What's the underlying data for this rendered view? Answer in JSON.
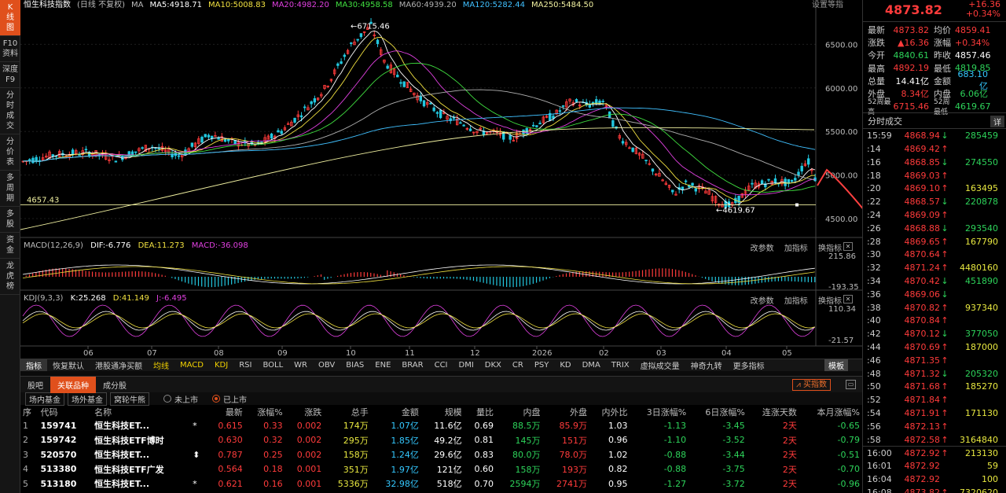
{
  "sidebar": [
    {
      "label": "K 线 图",
      "active": true
    },
    {
      "label": "F10 资料",
      "active": false
    },
    {
      "label": "深度 F9",
      "active": false
    },
    {
      "label": "分 时 成 交",
      "active": false
    },
    {
      "label": "分 价 表",
      "active": false
    },
    {
      "label": "多 周 期",
      "active": false
    },
    {
      "label": "多 股",
      "active": false
    },
    {
      "label": "资 金",
      "active": false
    },
    {
      "label": "龙 虎 榜",
      "active": false
    }
  ],
  "main_chart": {
    "header": [
      {
        "text": "恒生科技指数",
        "color": "#ffffff"
      },
      {
        "text": "(日线 不复权)",
        "color": "#bbbbbb"
      },
      {
        "text": "MA",
        "color": "#bbbbbb"
      },
      {
        "text": "MA5:4918.71",
        "color": "#ffffff"
      },
      {
        "text": "MA10:5008.83",
        "color": "#f0e040"
      },
      {
        "text": "MA20:4982.20",
        "color": "#e040e0"
      },
      {
        "text": "MA30:4958.58",
        "color": "#40e040"
      },
      {
        "text": "MA60:4939.20",
        "color": "#b0b0b0"
      },
      {
        "text": "MA120:5282.44",
        "color": "#40c0ff"
      },
      {
        "text": "MA250:5484.50",
        "color": "#f0f0a0"
      }
    ],
    "header_right": "设置等指",
    "high_label": "6715.46",
    "low_label": "4619.67",
    "ref_line_label": "4657.43",
    "y_ticks": [
      "6500.00",
      "6000.00",
      "5500.00",
      "5000.00",
      "4500.00"
    ],
    "x_ticks": [
      "06",
      "07",
      "08",
      "09",
      "10",
      "11",
      "12",
      "2026",
      "02",
      "03",
      "04",
      "05"
    ]
  },
  "macd": {
    "title": "MACD(12,26,9)",
    "dif": "DIF:-6.776",
    "dea": "DEA:11.273",
    "macd": "MACD:-36.098",
    "y_ticks": [
      "215.86",
      "-193.35"
    ]
  },
  "kdj": {
    "title": "KDJ(9,3,3)",
    "k": "K:25.268",
    "d": "D:41.149",
    "j": "J:-6.495",
    "y_ticks": [
      "110.34",
      "-21.57"
    ]
  },
  "pane_controls": [
    "改参数",
    "加指标",
    "换指标"
  ],
  "indicator_tabs": [
    "指标",
    "恢复默认",
    "港股通净买额",
    "均线",
    "MACD",
    "KDJ",
    "RSI",
    "BOLL",
    "WR",
    "OBV",
    "BIAS",
    "ENE",
    "BRAR",
    "CCI",
    "DMI",
    "DKX",
    "CR",
    "PSY",
    "KD",
    "DMA",
    "TRIX",
    "虚拟成交量",
    "神奇九转",
    "更多指标"
  ],
  "template_label": "模板",
  "bottom_tabs": [
    "股吧",
    "关联品种",
    "成分股"
  ],
  "buy_index_label": "买指数",
  "sub_tabs": [
    "场内基金",
    "场外基金",
    "窝轮牛熊"
  ],
  "radio": {
    "unlisted": "未上市",
    "listed": "已上市"
  },
  "table": {
    "headers": [
      "序",
      "代码",
      "名称",
      "",
      "最新",
      "涨幅%",
      "涨跌",
      "总手",
      "金额",
      "规模",
      "量比",
      "内盘",
      "外盘",
      "内外比",
      "3日涨幅%",
      "6日涨幅%",
      "连涨天数",
      "本月涨幅%"
    ],
    "rows": [
      {
        "idx": "1",
        "code": "159741",
        "name": "恒生科技ET...",
        "mark": "*",
        "last": "0.615",
        "pct": "0.33",
        "chg": "0.002",
        "vol": "174万",
        "amt": "1.07亿",
        "scale": "11.6亿",
        "vr": "0.69",
        "inner": "88.5万",
        "outer": "85.9万",
        "ratio": "1.03",
        "d3": "-1.13",
        "d6": "-3.45",
        "streak": "2天",
        "month": "-0.65"
      },
      {
        "idx": "2",
        "code": "159742",
        "name": "恒生科技ETF博时",
        "mark": "",
        "last": "0.630",
        "pct": "0.32",
        "chg": "0.002",
        "vol": "295万",
        "amt": "1.85亿",
        "scale": "49.2亿",
        "vr": "0.81",
        "inner": "145万",
        "outer": "151万",
        "ratio": "0.96",
        "d3": "-1.10",
        "d6": "-3.52",
        "streak": "2天",
        "month": "-0.79"
      },
      {
        "idx": "3",
        "code": "520570",
        "name": "恒生科技ET...",
        "mark": "⬍",
        "last": "0.787",
        "pct": "0.25",
        "chg": "0.002",
        "vol": "158万",
        "amt": "1.24亿",
        "scale": "29.6亿",
        "vr": "0.83",
        "inner": "80.0万",
        "outer": "78.0万",
        "ratio": "1.02",
        "d3": "-0.88",
        "d6": "-3.44",
        "streak": "2天",
        "month": "-0.51"
      },
      {
        "idx": "4",
        "code": "513380",
        "name": "恒生科技ETF广发",
        "mark": "",
        "last": "0.564",
        "pct": "0.18",
        "chg": "0.001",
        "vol": "351万",
        "amt": "1.97亿",
        "scale": "121亿",
        "vr": "0.60",
        "inner": "158万",
        "outer": "193万",
        "ratio": "0.82",
        "d3": "-0.88",
        "d6": "-3.75",
        "streak": "2天",
        "month": "-0.70"
      },
      {
        "idx": "5",
        "code": "513180",
        "name": "恒生科技ET...",
        "mark": "*",
        "last": "0.621",
        "pct": "0.16",
        "chg": "0.001",
        "vol": "5336万",
        "amt": "32.98亿",
        "scale": "518亿",
        "vr": "0.70",
        "inner": "2594万",
        "outer": "2741万",
        "ratio": "0.95",
        "d3": "-1.27",
        "d6": "-3.72",
        "streak": "2天",
        "month": "-0.96"
      }
    ]
  },
  "quote": {
    "price": "4873.82",
    "change": "+16.36",
    "change_pct": "+0.34%",
    "rows": [
      {
        "k": "最新",
        "v": "4873.82",
        "vc": "red",
        "k2": "均价",
        "v2": "4859.41",
        "v2c": "red"
      },
      {
        "k": "涨跌",
        "v": "▲16.36",
        "vc": "red",
        "k2": "涨幅",
        "v2": "+0.34%",
        "v2c": "red"
      },
      {
        "k": "今开",
        "v": "4840.61",
        "vc": "grn",
        "k2": "昨收",
        "v2": "4857.46",
        "v2c": "wht"
      },
      {
        "k": "最高",
        "v": "4892.19",
        "vc": "red",
        "k2": "最低",
        "v2": "4819.85",
        "v2c": "grn"
      },
      {
        "k": "总量",
        "v": "14.41亿",
        "vc": "wht",
        "k2": "金额",
        "v2": "683.10亿",
        "v2c": "cyn"
      },
      {
        "k": "外盘",
        "v": "8.34亿",
        "vc": "red",
        "k2": "内盘",
        "v2": "6.06亿",
        "v2c": "grn"
      },
      {
        "k": "52周最高",
        "v": "6715.46",
        "vc": "red",
        "k2": "52周最低",
        "v2": "4619.67",
        "v2c": "grn",
        "small": true
      }
    ]
  },
  "ticks_title": "分时成交",
  "ticks_detail": "详",
  "ticks": [
    {
      "t": "15:59",
      "p": "4868.94",
      "dir": "↓",
      "v": "285459"
    },
    {
      "t": ":14",
      "p": "4869.42",
      "dir": "↑",
      "v": ""
    },
    {
      "t": ":16",
      "p": "4868.85",
      "dir": "↓",
      "v": "274550"
    },
    {
      "t": ":18",
      "p": "4869.03",
      "dir": "↑",
      "v": ""
    },
    {
      "t": ":20",
      "p": "4869.10",
      "dir": "↑",
      "v": "163495"
    },
    {
      "t": ":22",
      "p": "4868.57",
      "dir": "↓",
      "v": "220878"
    },
    {
      "t": ":24",
      "p": "4869.09",
      "dir": "↑",
      "v": ""
    },
    {
      "t": ":26",
      "p": "4868.88",
      "dir": "↓",
      "v": "293540"
    },
    {
      "t": ":28",
      "p": "4869.65",
      "dir": "↑",
      "v": "167790"
    },
    {
      "t": ":30",
      "p": "4870.64",
      "dir": "↑",
      "v": ""
    },
    {
      "t": ":32",
      "p": "4871.24",
      "dir": "↑",
      "v": "4480160"
    },
    {
      "t": ":34",
      "p": "4870.42",
      "dir": "↓",
      "v": "451890"
    },
    {
      "t": ":36",
      "p": "4869.06",
      "dir": "↓",
      "v": ""
    },
    {
      "t": ":38",
      "p": "4870.82",
      "dir": "↑",
      "v": "937340"
    },
    {
      "t": ":40",
      "p": "4870.84",
      "dir": "↑",
      "v": ""
    },
    {
      "t": ":42",
      "p": "4870.12",
      "dir": "↓",
      "v": "377050"
    },
    {
      "t": ":44",
      "p": "4870.69",
      "dir": "↑",
      "v": "187000"
    },
    {
      "t": ":46",
      "p": "4871.35",
      "dir": "↑",
      "v": ""
    },
    {
      "t": ":48",
      "p": "4871.32",
      "dir": "↓",
      "v": "205320"
    },
    {
      "t": ":50",
      "p": "4871.68",
      "dir": "↑",
      "v": "185270"
    },
    {
      "t": ":52",
      "p": "4871.84",
      "dir": "↑",
      "v": ""
    },
    {
      "t": ":54",
      "p": "4871.91",
      "dir": "↑",
      "v": "171130"
    },
    {
      "t": ":56",
      "p": "4872.13",
      "dir": "↑",
      "v": ""
    },
    {
      "t": ":58",
      "p": "4872.58",
      "dir": "↑",
      "v": "3164840"
    },
    {
      "t": "16:00",
      "p": "4872.92",
      "dir": "↑",
      "v": "213130"
    },
    {
      "t": "16:01",
      "p": "4872.92",
      "dir": "",
      "v": "59"
    },
    {
      "t": "16:04",
      "p": "4872.92",
      "dir": "",
      "v": "100"
    },
    {
      "t": "16:08",
      "p": "4873.82",
      "dir": "↑",
      "v": "7320620"
    }
  ],
  "colors": {
    "up": "#ff3b3b",
    "down": "#2dd35a",
    "accent": "#e0501c",
    "ma5": "#ffffff",
    "ma10": "#f0e040",
    "ma20": "#e040e0",
    "ma30": "#40e040",
    "ma120": "#40c0ff",
    "ma250": "#f0f0a0"
  }
}
